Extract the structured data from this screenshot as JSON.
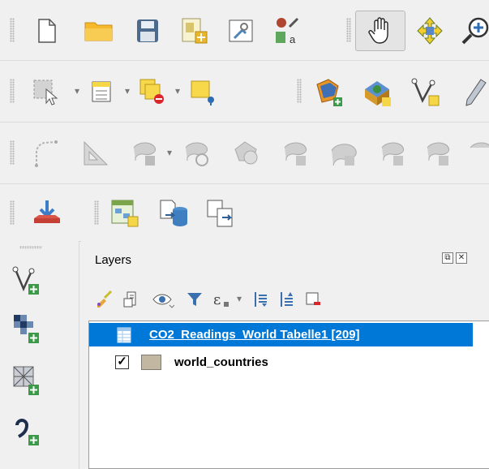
{
  "toolbars": {
    "file": [
      "new-project",
      "open-project",
      "save-project",
      "new-print-layout",
      "show-layout-manager",
      "style-manager",
      "pan-map",
      "pan-to-selection",
      "zoom-in"
    ],
    "selection": [
      "select-features",
      "open-attribute-table",
      "deselect-all",
      "select-by-value",
      "add-vector-layer",
      "add-raster-layer",
      "new-geopackage-layer",
      "digitize"
    ],
    "advanced_digitizing": [
      "add-circular-string",
      "add-triangle",
      "reshape-features",
      "rotate-features",
      "offset-curve",
      "simplify",
      "delete-ring",
      "delete-part",
      "split"
    ],
    "db": [
      "db-manager",
      "processing-toolbox",
      "import-to-db",
      "export-from-db"
    ]
  },
  "left_toolbar": [
    "new-shapefile-layer",
    "new-raster-layer",
    "new-mesh-layer",
    "new-temporary-layer"
  ],
  "layers_panel": {
    "title": "Layers",
    "float_glyph": "⧉",
    "close_glyph": "✕",
    "tools": [
      "style-layer",
      "add-group",
      "manage-visibility",
      "filter-legend",
      "filter-expression",
      "expand-all",
      "collapse-all",
      "remove-layer"
    ],
    "layers": [
      {
        "name": "CO2_Readings_World Tabelle1 [209]",
        "type": "table",
        "selected": true
      },
      {
        "name": "world_countries",
        "type": "polygon",
        "checked": true,
        "checkmark": "✓",
        "color": "#c2b7a0"
      }
    ]
  },
  "colors": {
    "selection": "#0078d7",
    "folder": "#f5b92b",
    "yellow": "#f8d84b"
  }
}
